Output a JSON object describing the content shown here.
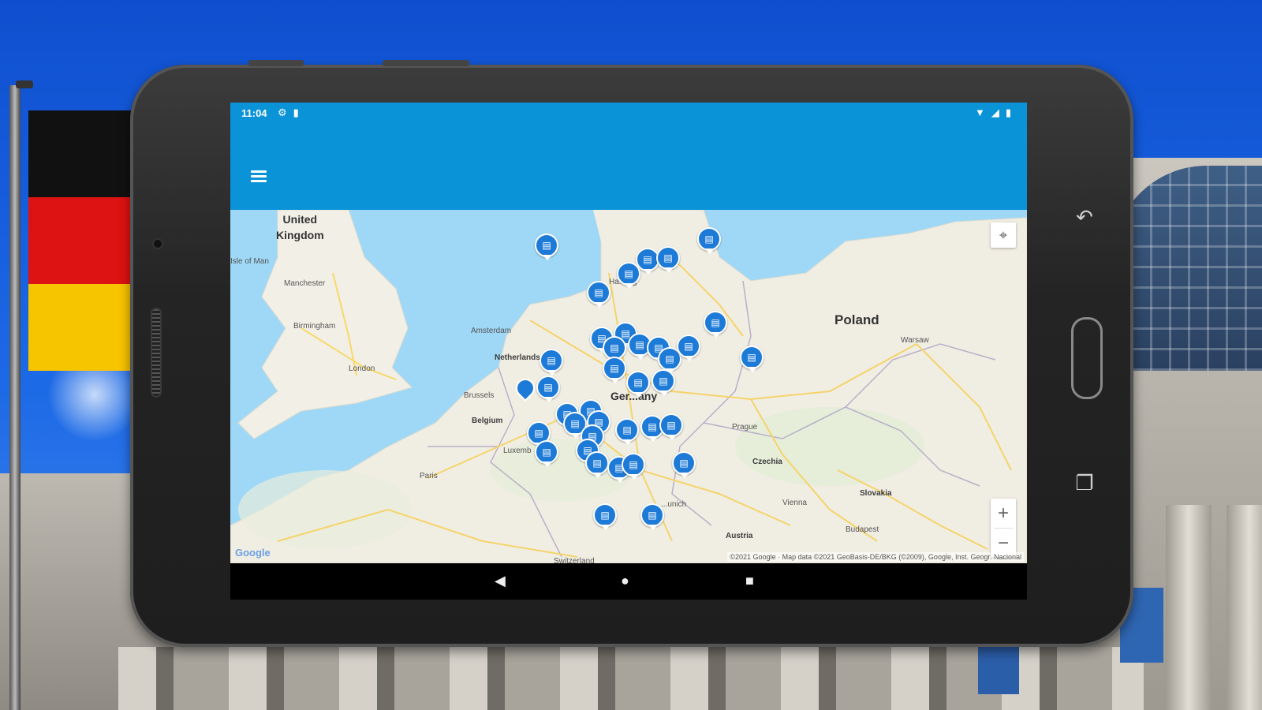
{
  "status_bar": {
    "time": "11:04",
    "left_icons": [
      "gear-icon",
      "sd-card-icon"
    ],
    "right_icons": [
      "wifi-icon",
      "signal-icon",
      "battery-icon"
    ]
  },
  "app_bar": {
    "menu_icon": "hamburger-menu-icon",
    "background_color": "#0b93d8"
  },
  "map": {
    "labels": {
      "united_kingdom": "United\nKingdom",
      "isle_of_man": "Isle of Man",
      "manchester": "Manchester",
      "birmingham": "Birmingham",
      "london": "London",
      "amsterdam": "Amsterdam",
      "netherlands": "Netherlands",
      "brussels": "Brussels",
      "belgium": "Belgium",
      "luxembourg": "Luxemb",
      "paris": "Paris",
      "germany": "Ger...any",
      "hamburg": "Ha...urg",
      "poland": "Poland",
      "warsaw": "Warsaw",
      "prague": "Prague",
      "czechia": "Czechia",
      "slovakia": "Slovakia",
      "vienna": "Vienna",
      "budapest": "Budapest",
      "austria": "Austria",
      "munich": "...unich",
      "switzerland": "Switzerland"
    },
    "marker_icon": "library-icon",
    "marker_color": "#1d7bd7",
    "locate_icon": "my-location-icon",
    "zoom_in": "+",
    "zoom_out": "−",
    "google_logo": "Google",
    "attribution": "©2021 Google · Map data ©2021 GeoBasis-DE/BKG (©2009), Google, Inst. Geogr. Nacional"
  },
  "nav_bar": {
    "back": "◀",
    "home": "●",
    "recents": "■"
  }
}
